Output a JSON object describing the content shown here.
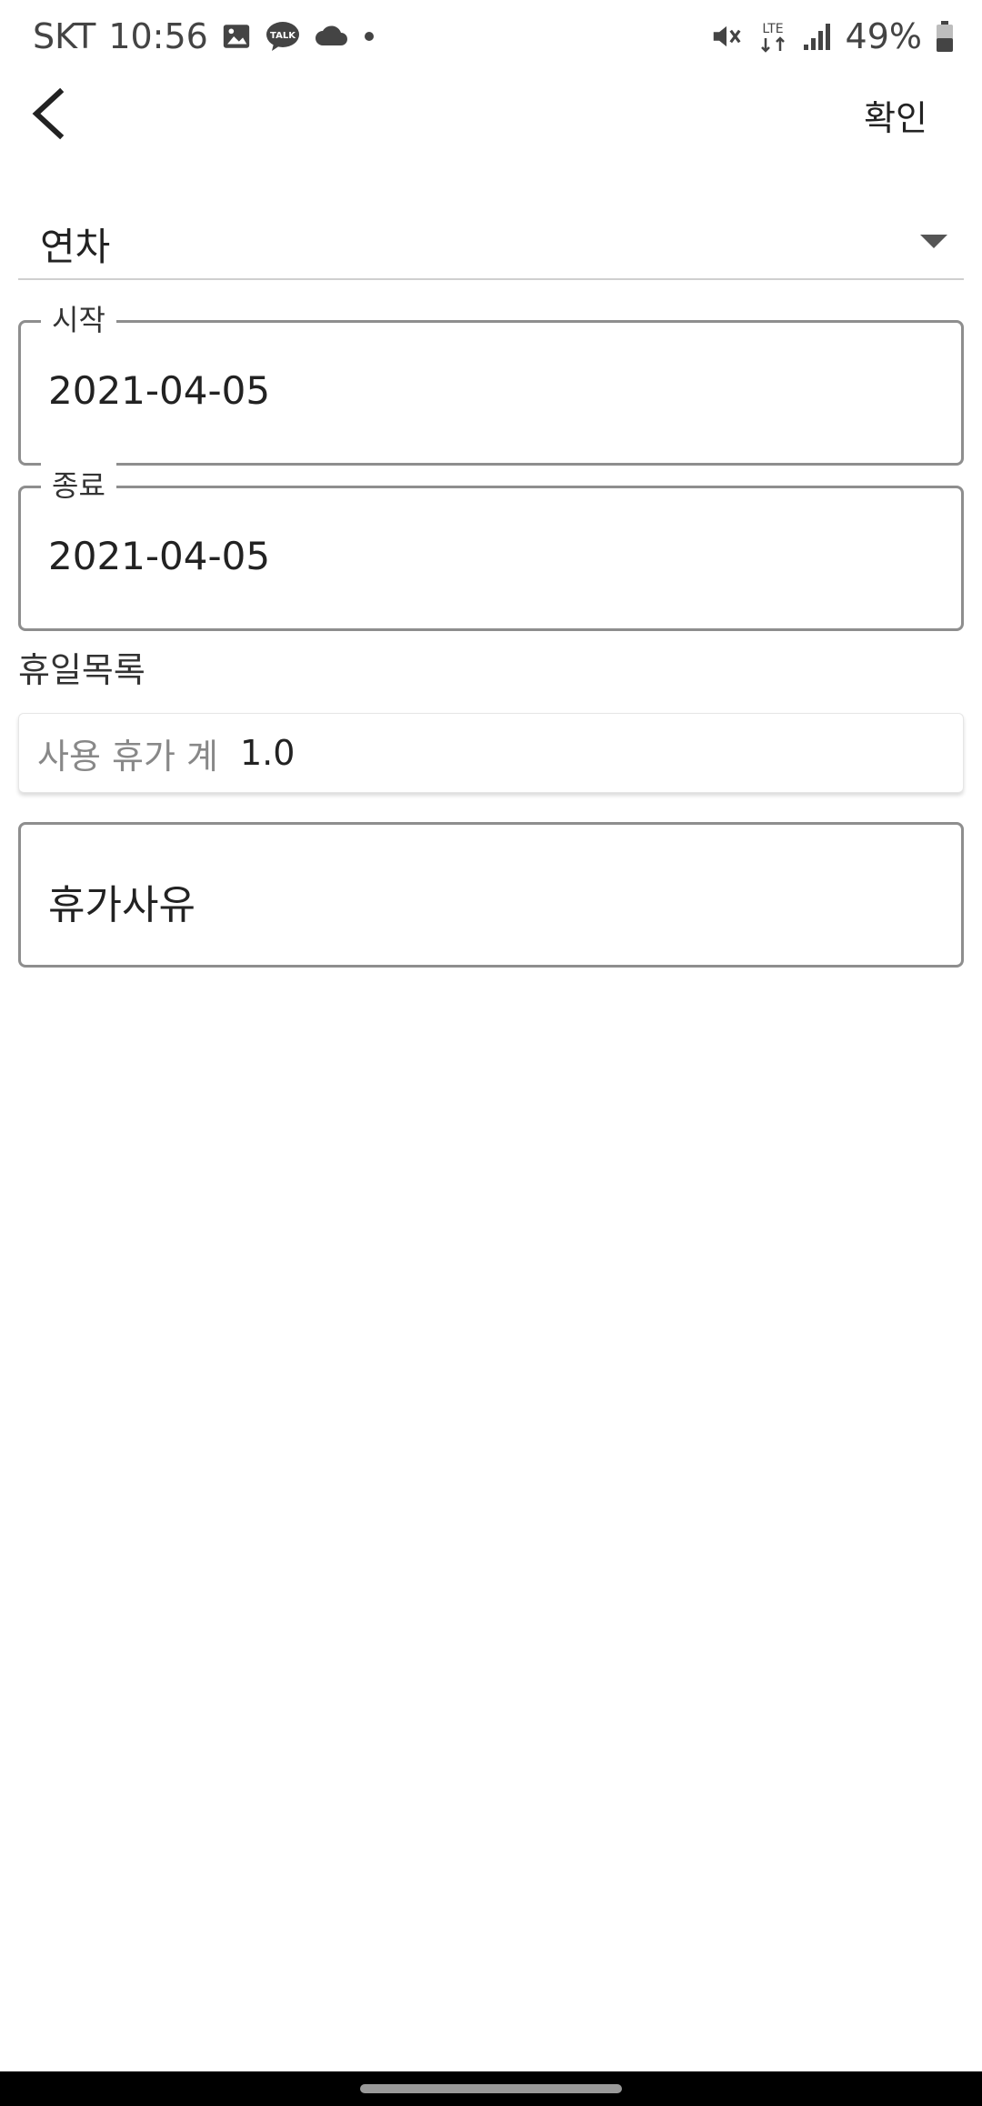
{
  "status_bar": {
    "carrier": "SKT",
    "time": "10:56",
    "network": "LTE",
    "battery": "49%",
    "icons": [
      "image-icon",
      "kakaotalk-icon",
      "cloud-icon",
      "dot-icon",
      "mute-icon",
      "lte-icon",
      "signal-icon",
      "battery-icon"
    ],
    "talk_badge": "TALK"
  },
  "app_bar": {
    "back_icon": "chevron-left-icon",
    "confirm_label": "확인"
  },
  "form": {
    "leave_type": "연차",
    "start": {
      "label": "시작",
      "value": "2021-04-05"
    },
    "end": {
      "label": "종료",
      "value": "2021-04-05"
    },
    "holiday_list_label": "휴일목록",
    "used_leave": {
      "label": "사용 휴가 계",
      "value": "1.0"
    },
    "reason_placeholder": "휴가사유"
  }
}
